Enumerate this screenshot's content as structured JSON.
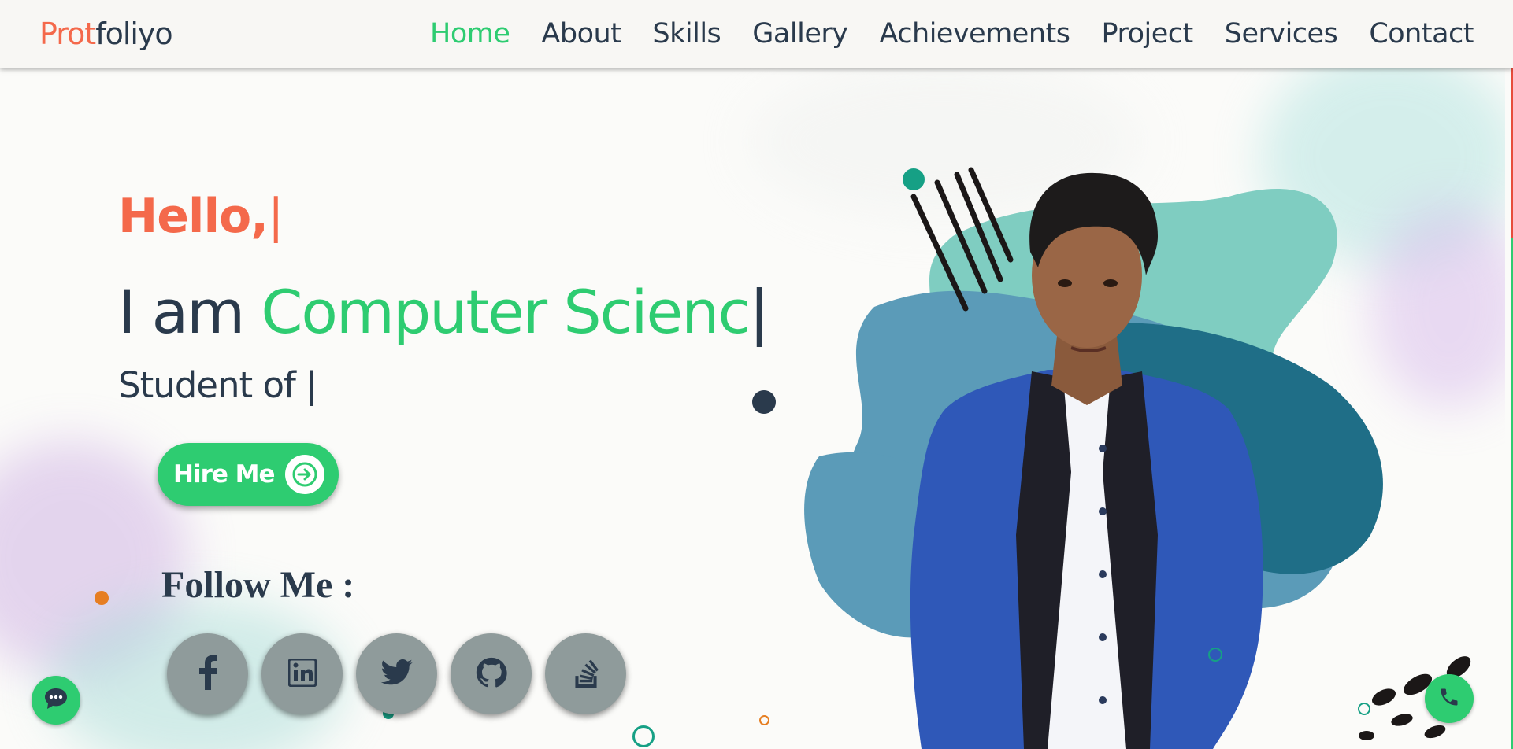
{
  "header": {
    "logo_part1": "Prot",
    "logo_part2": "foliyo",
    "nav": [
      {
        "label": "Home",
        "active": true
      },
      {
        "label": "About"
      },
      {
        "label": "Skills"
      },
      {
        "label": "Gallery"
      },
      {
        "label": "Achievements"
      },
      {
        "label": "Project"
      },
      {
        "label": "Services"
      },
      {
        "label": "Contact"
      }
    ]
  },
  "hero": {
    "greeting": "Hello,",
    "iam_prefix": "I am ",
    "role_typed": "Computer Scienc",
    "student_prefix": "Student of ",
    "caret": "|",
    "hire_label": "Hire Me"
  },
  "follow": {
    "title": "Follow Me :",
    "icons": [
      "facebook-icon",
      "linkedin-icon",
      "twitter-icon",
      "github-icon",
      "stackoverflow-icon"
    ]
  },
  "colors": {
    "accent_green": "#2ecc71",
    "accent_orange": "#f4694b",
    "text_dark": "#2a3a4c",
    "social_gray": "#8f9b9b"
  }
}
